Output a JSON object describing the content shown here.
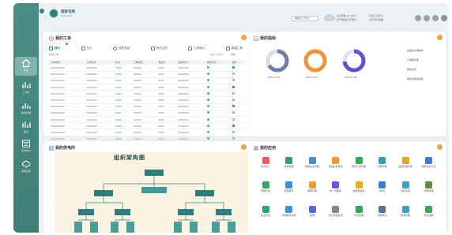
{
  "header": {
    "brand_name": "国家电网",
    "brand_sub": "State Grid",
    "workspace_select": "网格员工作台",
    "weather_line1": "多云转阴 22~28℃",
    "weather_line2": "空气质量良 东南风",
    "date_line1": "农历三月初七",
    "date_line2": "今日暂无提醒"
  },
  "rail": {
    "items": [
      {
        "label": "首页",
        "icon": "home-icon"
      },
      {
        "label": "工作台",
        "icon": "chart-icon"
      },
      {
        "label": "指标管理",
        "icon": "chart-icon"
      },
      {
        "label": "报表",
        "icon": "chart-icon"
      },
      {
        "label": "应用中心",
        "icon": "calendar-icon"
      },
      {
        "label": "系统设置",
        "icon": "cloud-icon"
      }
    ]
  },
  "work_orders": {
    "title": "我的工单",
    "tabs": [
      "待办",
      "已办",
      "我的发起",
      "我关注的",
      "工单统计",
      "新建工单"
    ],
    "badge": "2",
    "filter_label": "我的工单",
    "filter_search": "请输入关键字",
    "filter_refresh": "刷新",
    "columns": [
      "工单编号",
      "工单名称",
      "状态",
      "工单类型",
      "发起人",
      "接收时间",
      "剩余时长",
      "操作"
    ],
    "pager": [
      "<",
      "1",
      "2",
      "3",
      "4",
      "5",
      "6",
      "7",
      "8",
      "9",
      "10",
      ">"
    ]
  },
  "indicators": {
    "title": "我的指标",
    "rings": [
      {
        "date": "2022-03-05",
        "color": "#6f7fa8"
      },
      {
        "date": "2022-03-05",
        "color": "#f29236"
      },
      {
        "date": "2022-03-06",
        "color": "#5c55c9"
      }
    ],
    "list": [
      "设备在线率指标",
      "工单按时率",
      "事件处置",
      "服务满意度指标"
    ]
  },
  "supply": {
    "title": "我的供电所",
    "org_title": "组织架构图"
  },
  "apps": {
    "title": "我的应用",
    "items": [
      {
        "label": "综合办公",
        "color": "#e85c5c"
      },
      {
        "label": "供电地图",
        "color": "#2fa27a"
      },
      {
        "label": "营销业务管理",
        "color": "#3d8fe0"
      },
      {
        "label": "营销业务查询",
        "color": "#f09a28"
      },
      {
        "label": "移动工单管理",
        "color": "#39a857"
      },
      {
        "label": "问题管理",
        "color": "#25a7b0"
      },
      {
        "label": "设备管理系统",
        "color": "#f0a020"
      },
      {
        "label": "服务信息平台",
        "color": "#3a7bd5"
      },
      {
        "label": "营销应用",
        "color": "#35a55a"
      },
      {
        "label": "营销研究",
        "color": "#3d8fe0"
      },
      {
        "label": "客服管理",
        "color": "#f09a28"
      },
      {
        "label": "统一视图库",
        "color": "#7b4fd0"
      },
      {
        "label": "电能量采集",
        "color": "#e0b020"
      },
      {
        "label": "e助手",
        "color": "#2f7fd8"
      },
      {
        "label": "调控系统",
        "color": "#3aa0c8"
      },
      {
        "label": "配网管理",
        "color": "#5a8f3c"
      },
      {
        "label": "安全管控",
        "color": "#2fa27a"
      },
      {
        "label": "内网邮件系统",
        "color": "#3d8fe0"
      },
      {
        "label": "i国网",
        "color": "#4f6fd0"
      },
      {
        "label": "安全风险管控",
        "color": "#7a8a8a"
      },
      {
        "label": "光伏运维",
        "color": "#35a55a"
      },
      {
        "label": "智能电表",
        "color": "#5a6fa0"
      },
      {
        "label": "能源管理",
        "color": "#3aa0c8"
      },
      {
        "label": "网上国网",
        "color": "#3aa857"
      }
    ]
  }
}
